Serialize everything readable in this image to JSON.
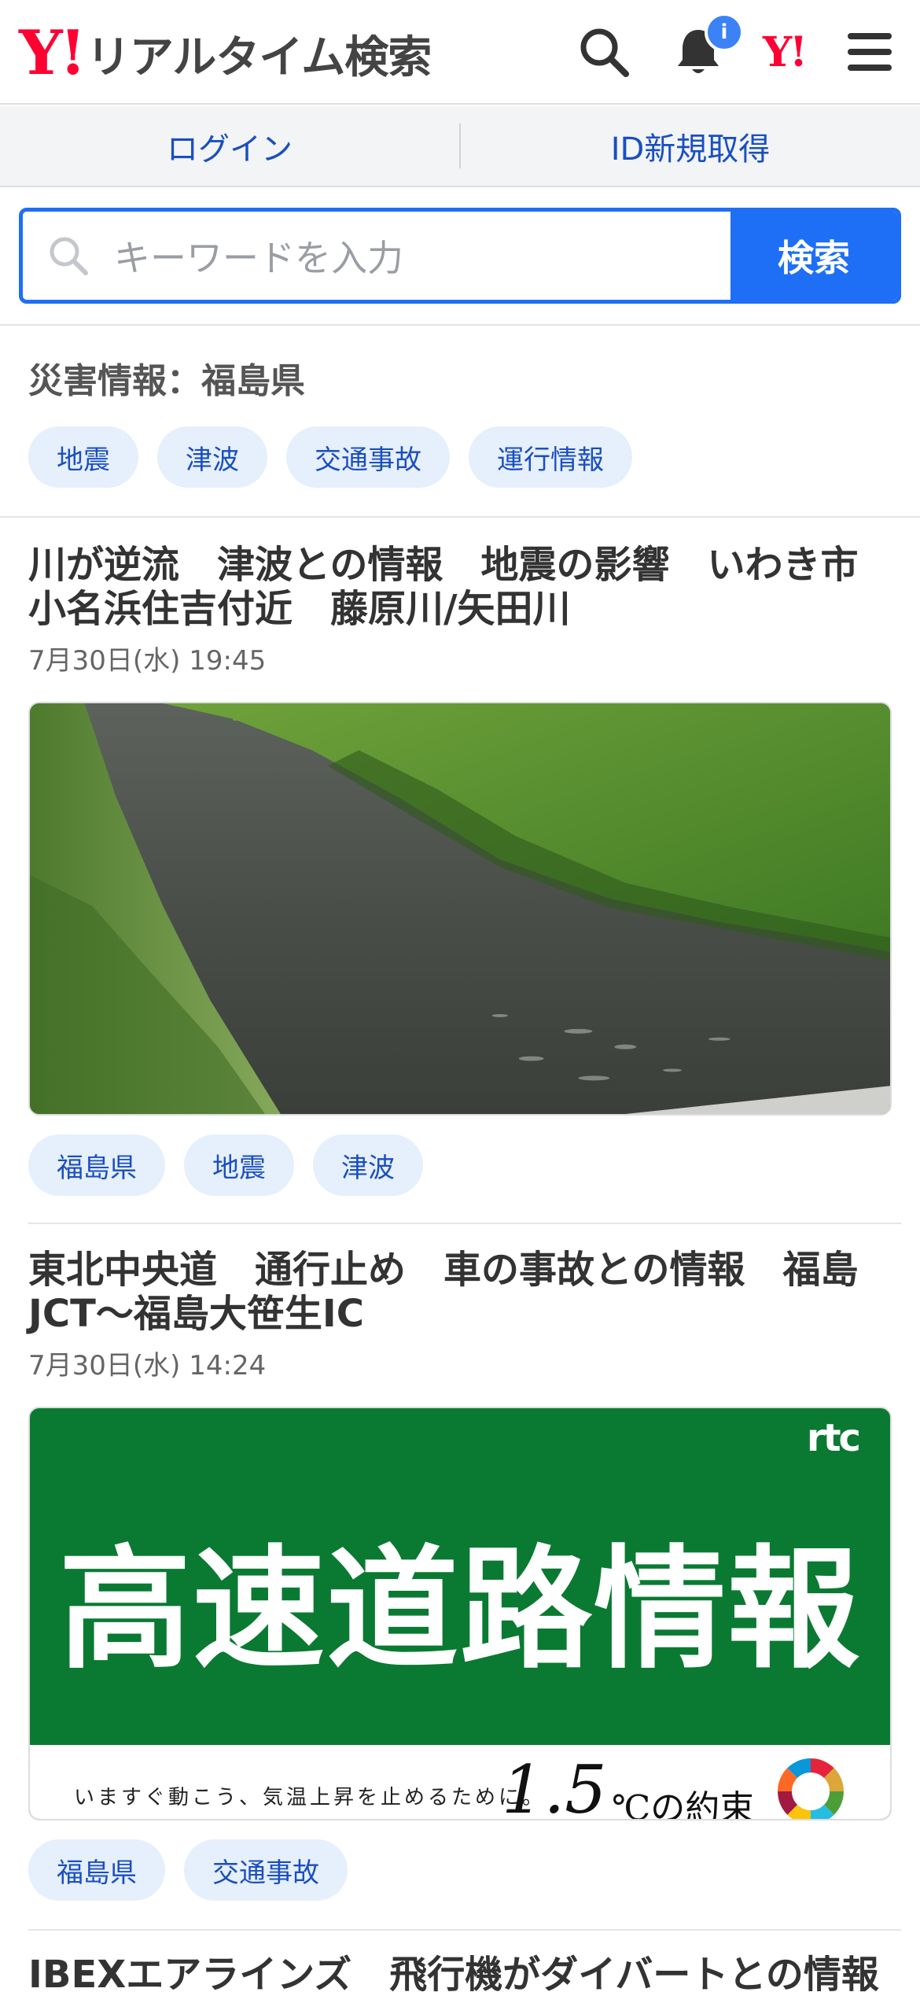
{
  "header": {
    "logo_mark": "Y!",
    "logo_text": "リアルタイム検索",
    "notification_badge": "i",
    "yahoo_mark": "Y!"
  },
  "auth": {
    "login_label": "ログイン",
    "signup_label": "ID新規取得"
  },
  "search": {
    "placeholder": "キーワードを入力",
    "button_label": "検索"
  },
  "disaster": {
    "title": "災害情報：福島県",
    "tags": [
      "地震",
      "津波",
      "交通事故",
      "運行情報"
    ]
  },
  "articles": [
    {
      "title": "川が逆流　津波との情報　地震の影響　いわき市小名浜住吉付近　藤原川/矢田川",
      "date": "7月30日(水) 19:45",
      "tags": [
        "福島県",
        "地震",
        "津波"
      ]
    },
    {
      "title": "東北中央道　通行止め　車の事故との情報　福島JCT～福島大笹生IC",
      "date": "7月30日(水) 14:24",
      "banner_mark": "rtc",
      "banner_text": "高速道路情報",
      "banner_slogan": "いますぐ動こう、気温上昇を止めるために。",
      "banner_number": "1.5",
      "banner_unit": "℃の約束",
      "tags": [
        "福島県",
        "交通事故"
      ]
    },
    {
      "title": "IBEXエアラインズ　飛行機がダイバートとの情報"
    }
  ],
  "colors": {
    "brand_red": "#ff0033",
    "accent_blue": "#1e6ff5",
    "chip_bg": "#e6effc",
    "chip_text": "#1a4fbf",
    "banner_green": "#0a7a32"
  }
}
